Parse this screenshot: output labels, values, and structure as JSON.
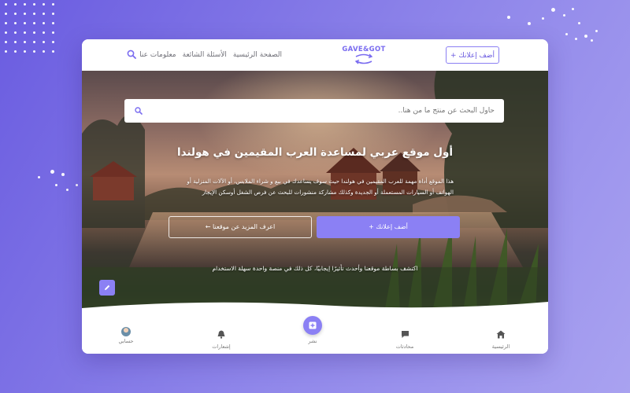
{
  "header": {
    "add_ad_label": "أضف إعلانك +",
    "logo_text": "GAVE&GOT",
    "nav_items": [
      "الصفحة الرئيسية",
      "الأسئلة الشائعة",
      "معلومات عنا"
    ],
    "search_icon": "search-icon"
  },
  "hero": {
    "search_placeholder": "حاول البحث عن منتج ما من هنا..",
    "title": "أول موقع عربي لمساعدة العرب المقيمين في هولندا",
    "description": "هذا الموقع أداة مهمة للعرب المقيمين في هولندا حيث سوف يساعدك في بيع و شراء الملابس، أو الآلات المنزلية أو الهواتف أو السيارات المستعملة أو الجديدة وكذلك مشاركة منشورات للبحث عن فرص الشغل أوسكن الإيجار",
    "add_button": "أضف إعلانك +",
    "more_button": "اعرف المزيد عن موقعنا ←",
    "tagline": "اكتشف بساطة موقعنا وأحدث تأثيرًا إيجابيًا، كل ذلك في منصة واحدة سهلة الاستخدام"
  },
  "bottom_nav": {
    "home": "الرئيسية",
    "chats": "محادثات",
    "post": "نشر",
    "notifications": "إشعارات",
    "account": "حسابي"
  },
  "colors": {
    "accent": "#8b80f4",
    "background": "#7a6ee6"
  }
}
